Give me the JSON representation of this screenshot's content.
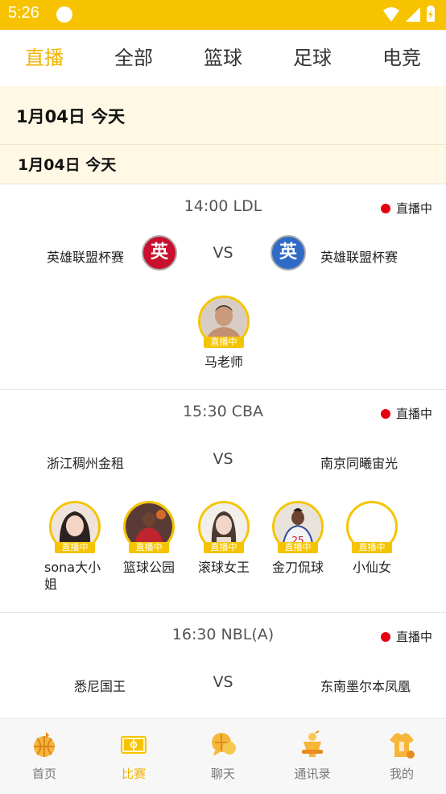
{
  "status": {
    "time": "5:26"
  },
  "tabs": [
    {
      "label": "直播",
      "active": true
    },
    {
      "label": "全部",
      "active": false
    },
    {
      "label": "篮球",
      "active": false
    },
    {
      "label": "足球",
      "active": false
    },
    {
      "label": "电竞",
      "active": false
    }
  ],
  "date_header": "1月04日  今天",
  "date_subheader": "1月04日   今天",
  "matches": [
    {
      "title": "14:00 LDL",
      "live_label": "直播中",
      "home": "英雄联盟杯赛",
      "away": "英雄联盟杯赛",
      "home_badge": "英",
      "away_badge": "英",
      "vs": "VS",
      "streamers": [
        {
          "name": "马老师",
          "tag": "直播中"
        }
      ]
    },
    {
      "title": "15:30 CBA",
      "live_label": "直播中",
      "home": "浙江稠州金租",
      "away": "南京同曦宙光",
      "vs": "VS",
      "streamers": [
        {
          "name": "sona大小姐",
          "tag": "直播中"
        },
        {
          "name": "篮球公园",
          "tag": "直播中"
        },
        {
          "name": "滚球女王",
          "tag": "直播中"
        },
        {
          "name": "金刀侃球",
          "tag": "直播中"
        },
        {
          "name": "小仙女",
          "tag": "直播中"
        }
      ]
    },
    {
      "title": "16:30 NBL(A)",
      "live_label": "直播中",
      "home": "悉尼国王",
      "away": "东南墨尔本凤凰",
      "vs": "VS"
    }
  ],
  "bottom_nav": [
    {
      "label": "首页",
      "icon": "home-basketball-icon",
      "active": false
    },
    {
      "label": "比赛",
      "icon": "court-icon",
      "active": true
    },
    {
      "label": "聊天",
      "icon": "chat-bubble-icon",
      "active": false
    },
    {
      "label": "通讯录",
      "icon": "trophy-icon",
      "active": false
    },
    {
      "label": "我的",
      "icon": "jersey-icon",
      "active": false
    }
  ],
  "colors": {
    "accent": "#f7c300",
    "live_dot": "#e4000f",
    "badge_red": "#c8102e",
    "badge_blue": "#2f6bc6"
  }
}
